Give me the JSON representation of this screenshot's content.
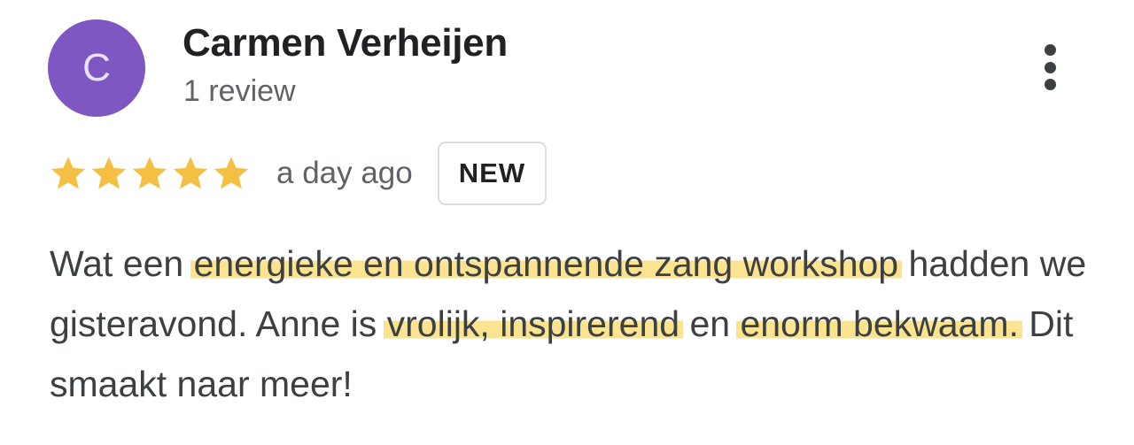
{
  "reviewer": {
    "avatar_letter": "C",
    "avatar_color": "#7e57c2",
    "name": "Carmen Verheijen",
    "review_count": "1 review"
  },
  "rating": {
    "stars": 5,
    "max_stars": 5,
    "star_color": "#f4bf42",
    "date": "a day ago",
    "badge": "NEW"
  },
  "review": {
    "seg1": "Wat een ",
    "hl1": "energieke en ontspannende zang workshop",
    "seg2": " hadden we gisteravond. Anne is ",
    "hl2": "vrolijk, inspirerend",
    "seg3": " en ",
    "hl3": "enorm bekwaam.",
    "seg4": " Dit smaakt naar meer!",
    "highlight_color": "#fbe38f"
  },
  "menu": {
    "icon": "more-vertical-icon"
  }
}
